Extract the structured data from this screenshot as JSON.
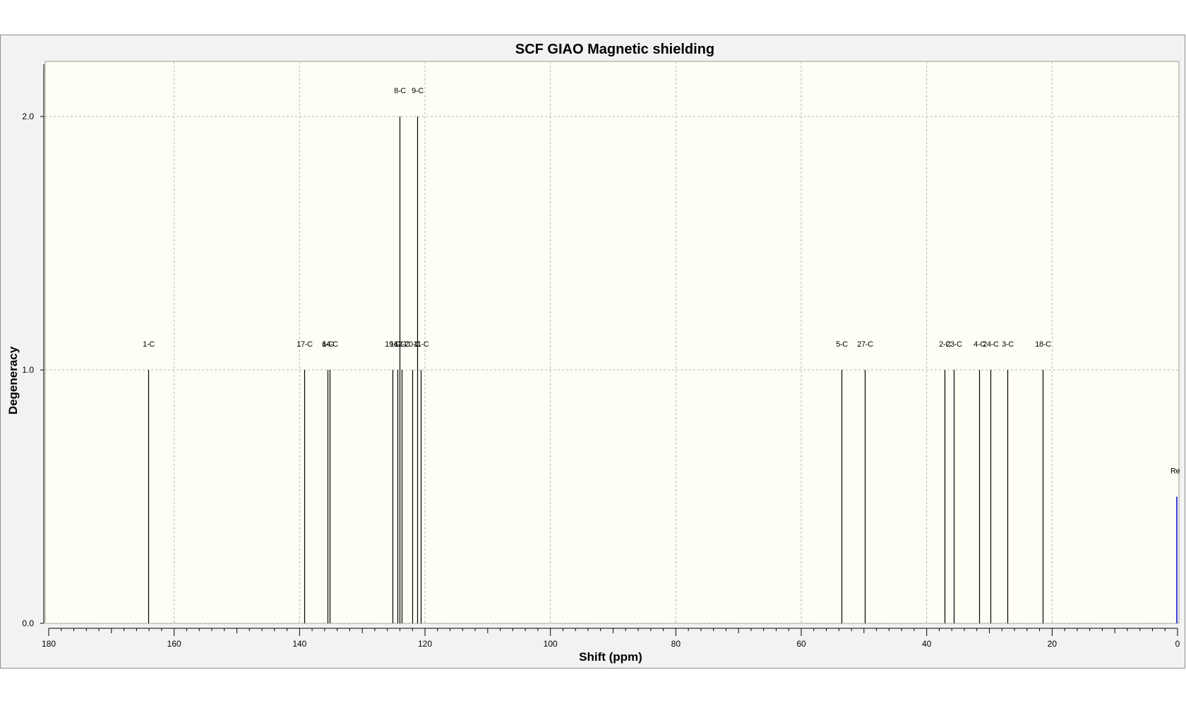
{
  "chart_data": {
    "type": "bar",
    "title": "SCF GIAO Magnetic shielding",
    "xlabel": "Shift (ppm)",
    "ylabel": "Degeneracy",
    "xlim": [
      180,
      0
    ],
    "ylim": [
      0,
      2.2
    ],
    "x_reversed": true,
    "x_ticks": [
      "180",
      "160",
      "140",
      "120",
      "100",
      "80",
      "60",
      "40",
      "20",
      "0"
    ],
    "y_ticks": [
      "0.0",
      "1.0",
      "2.0"
    ],
    "grid": true,
    "colors": {
      "plot_bg": "#fffef4",
      "frame_bg": "#f2f2f2",
      "grid": "#b4b4b4",
      "peak": "#000000",
      "reference": "#0000cc"
    },
    "peaks": [
      {
        "label": "1-C",
        "x": 164.1,
        "y": 1
      },
      {
        "label": "17-C",
        "x": 139.3,
        "y": 1
      },
      {
        "label": "6-C",
        "x": 135.5,
        "y": 1
      },
      {
        "label": "14-C",
        "x": 135.2,
        "y": 1
      },
      {
        "label": "19-C",
        "x": 125.2,
        "y": 1
      },
      {
        "label": "16-C",
        "x": 124.4,
        "y": 1
      },
      {
        "label": "8-C",
        "x": 124.1,
        "y": 2
      },
      {
        "label": "12-C",
        "x": 123.7,
        "y": 1
      },
      {
        "label": "20-C",
        "x": 122.0,
        "y": 1
      },
      {
        "label": "9-C",
        "x": 121.2,
        "y": 2
      },
      {
        "label": "11-C",
        "x": 120.7,
        "y": 1
      },
      {
        "label": "5-C",
        "x": 53.6,
        "y": 1
      },
      {
        "label": "27-C",
        "x": 49.9,
        "y": 1
      },
      {
        "label": "2-C",
        "x": 37.2,
        "y": 1
      },
      {
        "label": "23-C",
        "x": 35.7,
        "y": 1
      },
      {
        "label": "4-C",
        "x": 31.6,
        "y": 1
      },
      {
        "label": "24-C",
        "x": 29.8,
        "y": 1
      },
      {
        "label": "3-C",
        "x": 27.1,
        "y": 1
      },
      {
        "label": "18-C",
        "x": 21.5,
        "y": 1
      }
    ],
    "reference": {
      "label": "Re",
      "x": 0.0,
      "y": 0.5
    }
  }
}
